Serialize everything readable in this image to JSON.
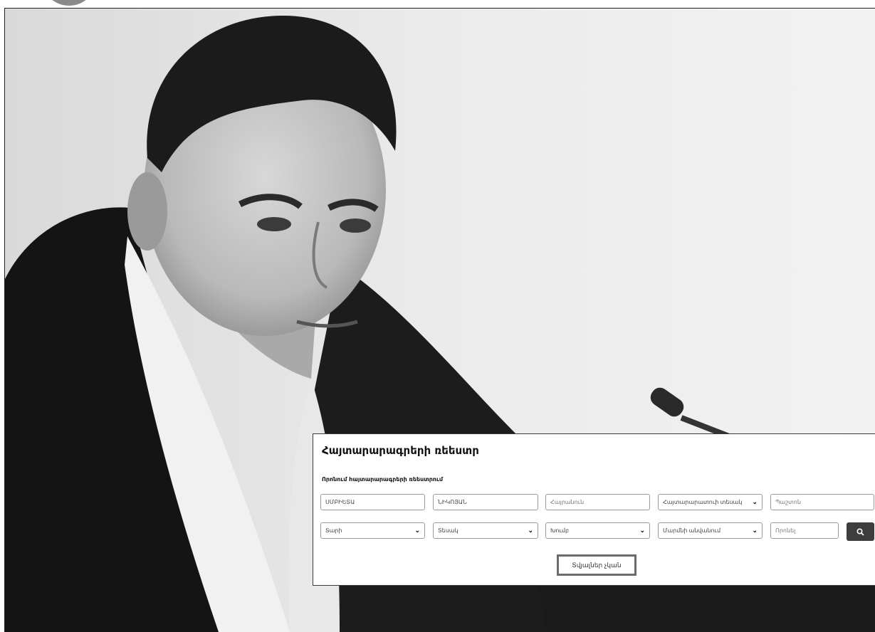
{
  "registry": {
    "title": "Հայտարարագրերի ռեեստր",
    "subtitle": "Որոնում հայտարարագրերի ռեեստրում",
    "first_name_value": "ՍՄԲԻԵՏԱ",
    "last_name_value": "ՆԻԿՈՅԱՆ",
    "patronymic_placeholder": "Հայրանուն",
    "declaration_type_label": "Հայտարարատուի տեսակ",
    "position_placeholder": "Պաշտոն",
    "year_label": "Տարի",
    "type_label": "Տեսակ",
    "group_label": "Խումբ",
    "body_label": "Մարմնի անվանում",
    "search_placeholder": "Որոնել",
    "no_data_text": "Տվյալներ չկան"
  },
  "icons": {
    "search_button_icon": "search-icon",
    "dropdown_icon": "chevron-down-icon"
  },
  "colors": {
    "panel_background": "#ffffff",
    "search_button": "#3d3d3d"
  }
}
